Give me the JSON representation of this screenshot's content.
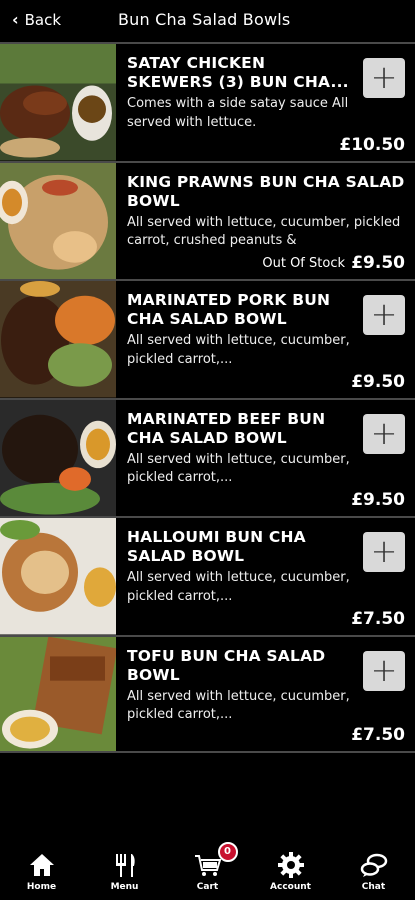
{
  "header": {
    "back_label": "Back",
    "title": "Bun Cha Salad Bowls"
  },
  "items": [
    {
      "name": "SATAY CHICKEN SKEWERS (3) BUN CHA...",
      "desc": "Comes with a side satay sauce All served with lettuce.",
      "price": "£10.50",
      "add": "+"
    },
    {
      "name": "KING PRAWNS BUN CHA SALAD BOWL",
      "desc": "All served with lettuce, cucumber, pickled carrot, crushed peanuts &",
      "price": "£9.50",
      "status": "Out Of Stock"
    },
    {
      "name": "MARINATED PORK BUN CHA SALAD BOWL",
      "desc": "All served with lettuce, cucumber, pickled carrot,...",
      "price": "£9.50",
      "add": "+"
    },
    {
      "name": "MARINATED BEEF BUN CHA SALAD BOWL",
      "desc": "All served with lettuce, cucumber, pickled carrot,...",
      "price": "£9.50",
      "add": "+"
    },
    {
      "name": "HALLOUMI BUN CHA SALAD BOWL",
      "desc": "All served with lettuce, cucumber, pickled carrot,...",
      "price": "£7.50",
      "add": "+"
    },
    {
      "name": "TOFU BUN CHA SALAD BOWL",
      "desc": "All served with lettuce, cucumber, pickled carrot,...",
      "price": "£7.50",
      "add": "+"
    }
  ],
  "nav": {
    "home": "Home",
    "menu": "Menu",
    "cart": "Cart",
    "cart_count": "0",
    "account": "Account",
    "chat": "Chat"
  },
  "colors": {
    "badge": "#c8102e",
    "add_button": "#d9d9d9",
    "divider": "#4a4a4a"
  }
}
